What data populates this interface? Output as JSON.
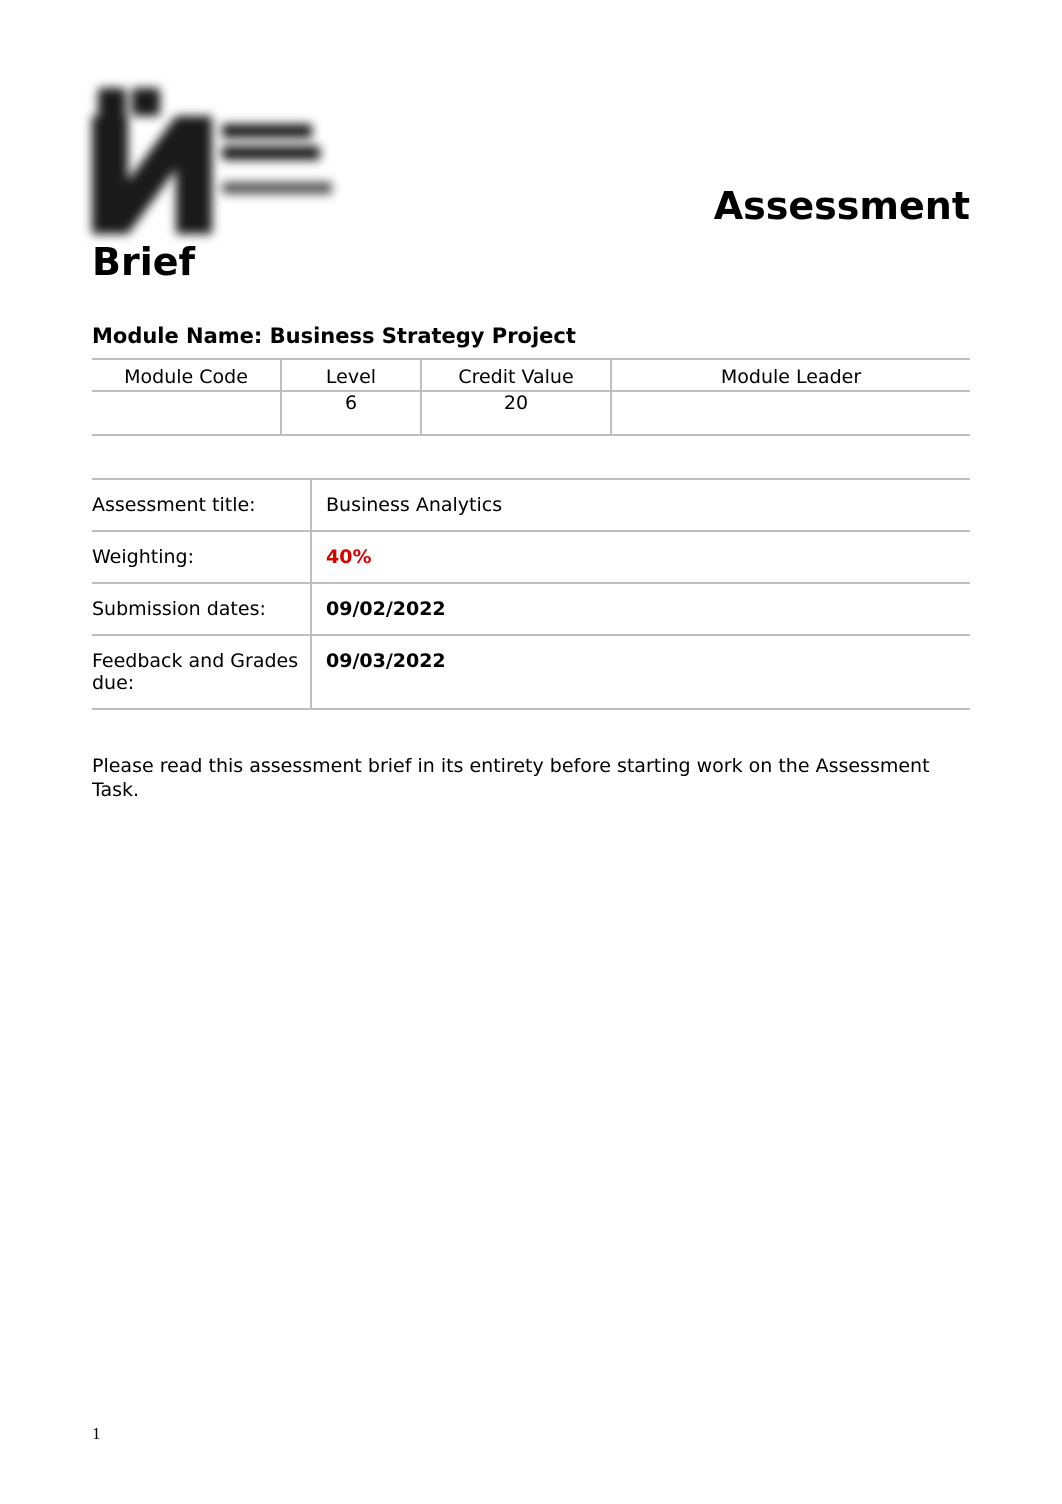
{
  "title": {
    "line1": "Assessment",
    "line2": "Brief"
  },
  "module_name_label": "Module Name: Business Strategy Project",
  "info_table": {
    "headers": {
      "code": "Module Code",
      "level": "Level",
      "credit": "Credit Value",
      "leader": "Module Leader"
    },
    "values": {
      "code": "",
      "level": "6",
      "credit": "20",
      "leader": ""
    }
  },
  "details": {
    "rows": [
      {
        "label": "Assessment title:",
        "value": "Business Analytics",
        "style": "plain"
      },
      {
        "label": "Weighting:",
        "value": "40%",
        "style": "red-bold"
      },
      {
        "label": "Submission dates:",
        "value": "09/02/2022",
        "style": "bold"
      },
      {
        "label": "Feedback and Grades due:",
        "value": "09/03/2022",
        "style": "bold"
      }
    ]
  },
  "note": "Please read this assessment brief in its entirety before starting work on the Assessment Task.",
  "page_number": "1"
}
